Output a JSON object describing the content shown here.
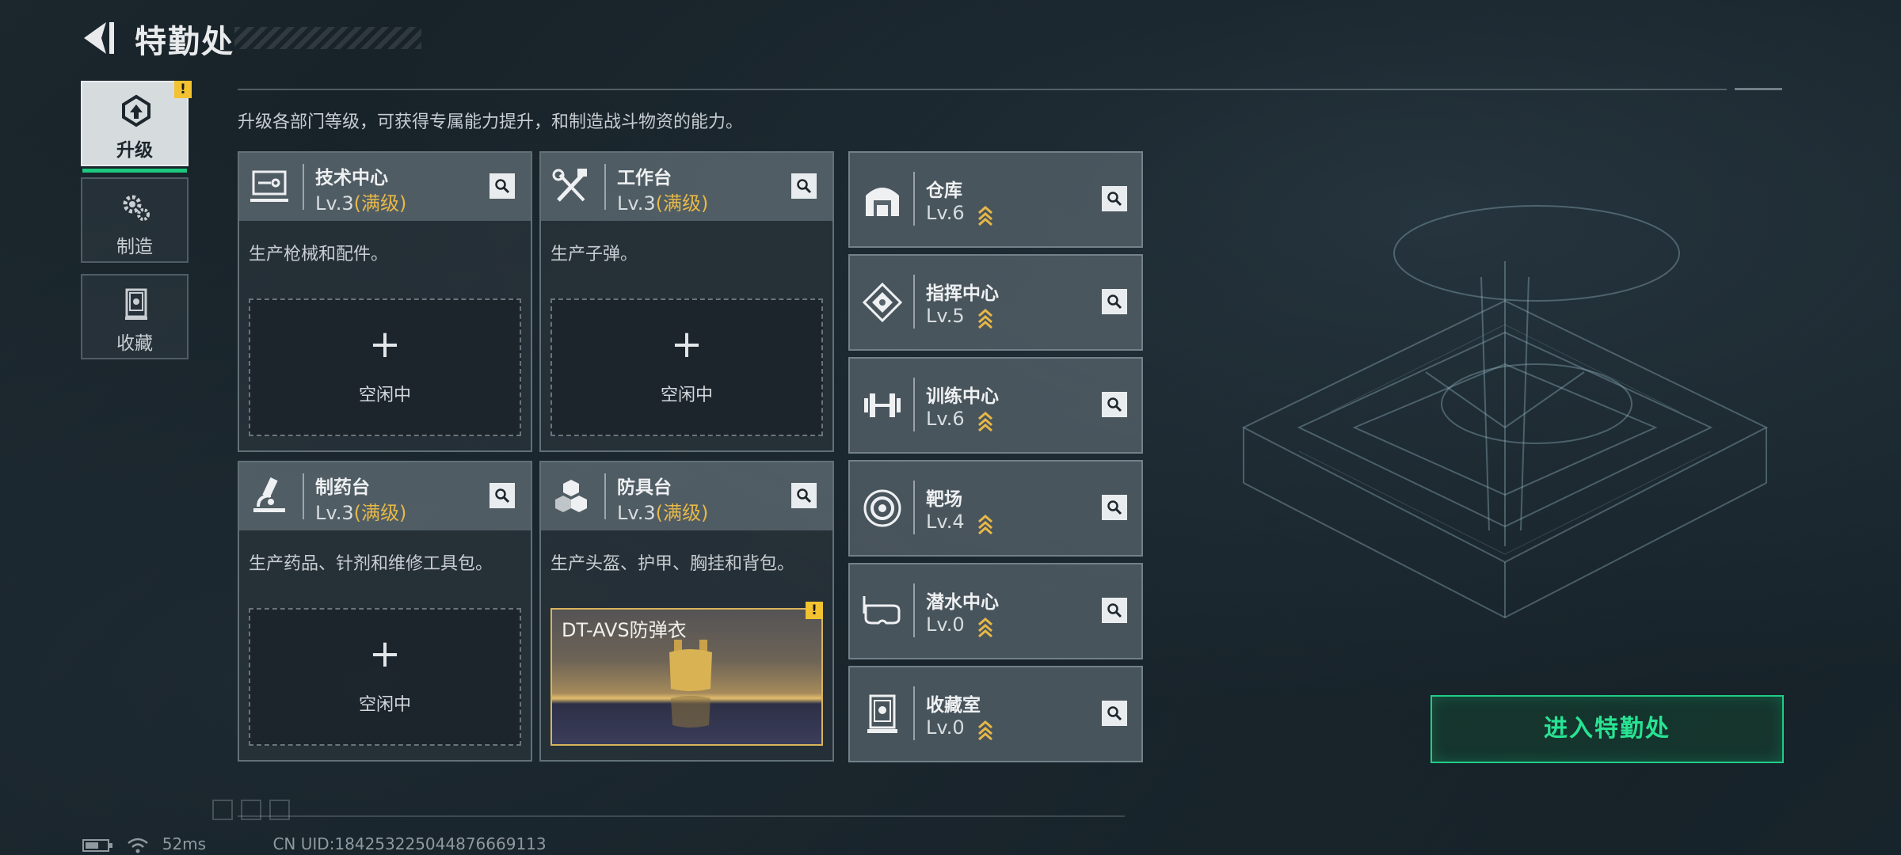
{
  "header": {
    "title": "特勤处"
  },
  "sidebar": {
    "tabs": [
      {
        "label": "升级",
        "icon": "upgrade-icon",
        "active": true,
        "alert": "!"
      },
      {
        "label": "制造",
        "icon": "gears-icon",
        "active": false
      },
      {
        "label": "收藏",
        "icon": "collection-icon",
        "active": false
      }
    ]
  },
  "description": "升级各部门等级，可获得专属能力提升，和制造战斗物资的能力。",
  "departments": [
    {
      "name": "技术中心",
      "level": "Lv.3",
      "max": "(满级)",
      "desc": "生产枪械和配件。",
      "icon": "computer-icon",
      "slot": {
        "type": "idle",
        "plus": "+",
        "label": "空闲中"
      }
    },
    {
      "name": "工作台",
      "level": "Lv.3",
      "max": "(满级)",
      "desc": "生产子弹。",
      "icon": "tools-icon",
      "slot": {
        "type": "idle",
        "plus": "+",
        "label": "空闲中"
      }
    },
    {
      "name": "制药台",
      "level": "Lv.3",
      "max": "(满级)",
      "desc": "生产药品、针剂和维修工具包。",
      "icon": "microscope-icon",
      "slot": {
        "type": "idle",
        "plus": "+",
        "label": "空闲中"
      }
    },
    {
      "name": "防具台",
      "level": "Lv.3",
      "max": "(满级)",
      "desc": "生产头盔、护甲、胸挂和背包。",
      "icon": "armor-cubes-icon",
      "slot": {
        "type": "product",
        "label": "DT-AVS防弹衣",
        "alert": "!"
      }
    }
  ],
  "buildings": [
    {
      "name": "仓库",
      "level": "Lv.6",
      "icon": "warehouse-icon"
    },
    {
      "name": "指挥中心",
      "level": "Lv.5",
      "icon": "command-icon"
    },
    {
      "name": "训练中心",
      "level": "Lv.6",
      "icon": "dumbbell-icon"
    },
    {
      "name": "靶场",
      "level": "Lv.4",
      "icon": "target-icon"
    },
    {
      "name": "潜水中心",
      "level": "Lv.0",
      "icon": "diving-mask-icon"
    },
    {
      "name": "收藏室",
      "level": "Lv.0",
      "icon": "display-case-icon"
    }
  ],
  "enter_button": "进入特勤处",
  "footer": {
    "ping": "52ms",
    "uid": "CN UID:18425322504487666​9113"
  },
  "colors": {
    "accent_green": "#1fcd86",
    "max_level_gold": "#e6b848",
    "alert_yellow": "#f2c230"
  }
}
